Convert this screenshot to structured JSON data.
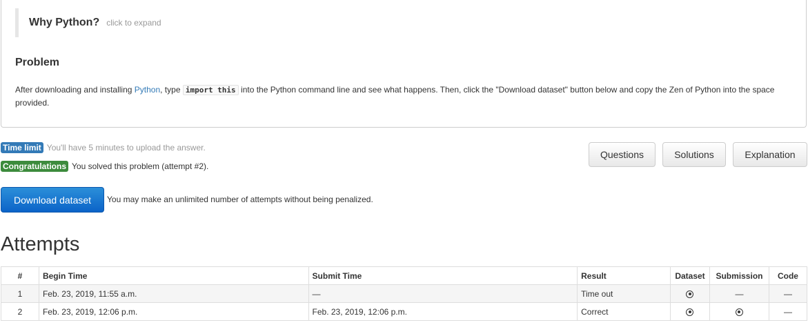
{
  "why": {
    "title": "Why Python?",
    "hint": "click to expand"
  },
  "problem": {
    "title": "Problem",
    "text_before_link": "After downloading and installing ",
    "link": "Python",
    "text_before_code": ", type ",
    "code": "import this",
    "text_after_code": " into the Python command line and see what happens. Then, click the \"Download dataset\" button below and copy the Zen of Python into the space provided."
  },
  "status": {
    "time_limit_badge": "Time limit",
    "time_limit_text": "You'll have 5 minutes to upload the answer.",
    "congrats_badge": "Congratulations",
    "congrats_text": "You solved this problem (attempt #2)."
  },
  "buttons": {
    "questions": "Questions",
    "solutions": "Solutions",
    "explanation": "Explanation"
  },
  "download": {
    "label": "Download dataset",
    "note": "You may make an unlimited number of attempts without being penalized."
  },
  "attempts": {
    "title": "Attempts",
    "headers": [
      "#",
      "Begin Time",
      "Submit Time",
      "Result",
      "Dataset",
      "Submission",
      "Code"
    ],
    "rows": [
      {
        "num": "1",
        "begin": "Feb. 23, 2019, 11:55 a.m.",
        "submit": "—",
        "result": "Time out",
        "dataset_icon": "download-icon",
        "submission": "—",
        "code": "—"
      },
      {
        "num": "2",
        "begin": "Feb. 23, 2019, 12:06 p.m.",
        "submit": "Feb. 23, 2019, 12:06 p.m.",
        "result": "Correct",
        "dataset_icon": "download-icon",
        "submission_icon": "download-icon",
        "code": "—"
      }
    ]
  },
  "colors": {
    "link": "#337ab7",
    "info_badge": "#337ab7",
    "success_badge": "#3c8b3c",
    "primary_button": "#0b63c8"
  }
}
